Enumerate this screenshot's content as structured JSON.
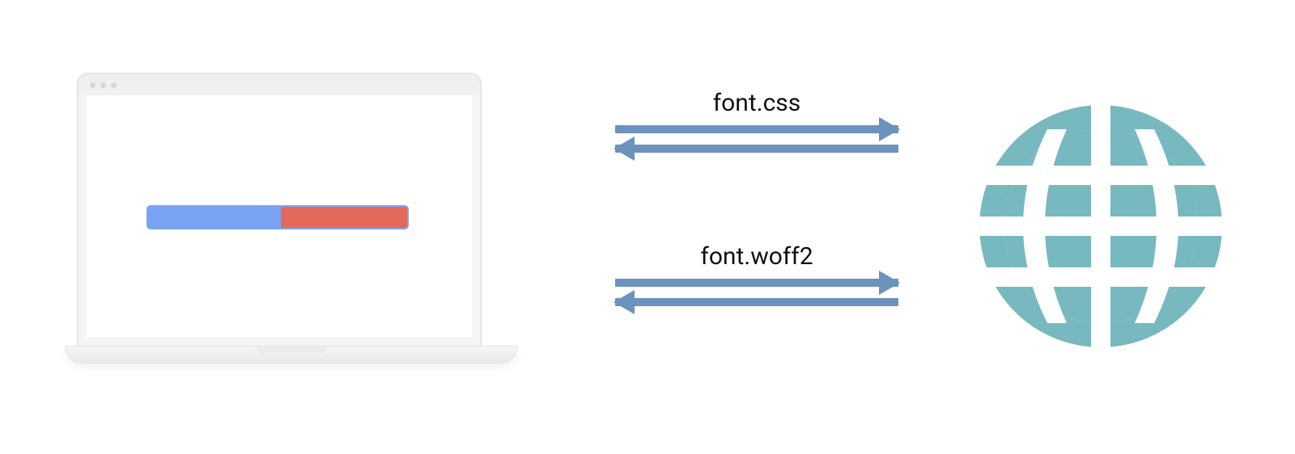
{
  "requests": {
    "top_label": "font.css",
    "bottom_label": "font.woff2"
  },
  "colors": {
    "arrow": "#6c92be",
    "globe": "#78b8bf",
    "progress_bg": "#7aa4f3",
    "progress_fill": "#e36a5a"
  },
  "progress": {
    "fill_percent": 48
  }
}
